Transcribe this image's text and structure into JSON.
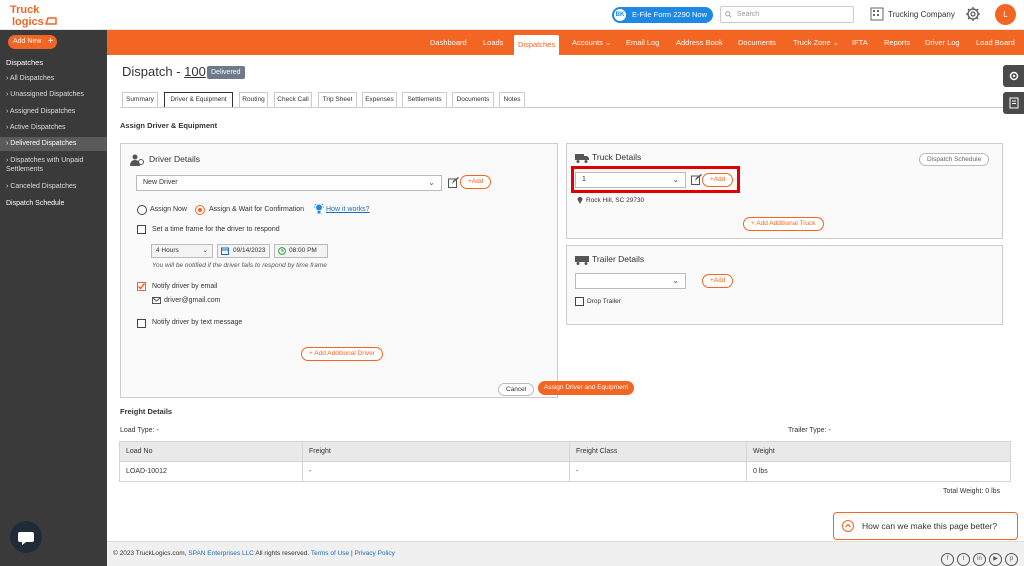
{
  "app": {
    "logo_line1": "Truck",
    "logo_line2": "logics"
  },
  "topbar": {
    "efile_badge": "BK",
    "efile_label": "E-File Form 2290 Now",
    "search_placeholder": "Search",
    "company": "Trucking Company",
    "avatar": "L"
  },
  "sidebar": {
    "add_new": "Add New",
    "section": "Dispatches",
    "items": [
      {
        "label": "All Dispatches"
      },
      {
        "label": "Unassigned Dispatches"
      },
      {
        "label": "Assigned Dispatches"
      },
      {
        "label": "Active Dispatches"
      },
      {
        "label": "Delivered Dispatches"
      },
      {
        "label": "Dispatches with Unpaid Settlements"
      },
      {
        "label": "Canceled Dispatches"
      }
    ],
    "schedule": "Dispatch Schedule"
  },
  "nav": {
    "items": [
      "Dashboard",
      "Loads",
      "Dispatches",
      "Accounts ⌄",
      "Email Log",
      "Address Book",
      "Documents",
      "Truck Zone ⌄",
      "IFTA",
      "Reports",
      "Driver Log",
      "Load Board"
    ]
  },
  "page": {
    "title_prefix": "Dispatch - ",
    "dispatch_no": "100",
    "status": "Delivered"
  },
  "tabs": [
    "Summary",
    "Driver & Equipment",
    "Routing",
    "Check Call",
    "Trip Sheet",
    "Expenses",
    "Settlements",
    "Documents",
    "Notes"
  ],
  "assign": {
    "heading": "Assign Driver & Equipment",
    "driver": {
      "title": "Driver Details",
      "select_value": "New Driver",
      "add": "+Add",
      "assign_now": "Assign Now",
      "assign_wait": "Assign & Wait for Confirmation",
      "how": "How it works?",
      "timeframe": "Set a time frame for the driver to respond",
      "hours": "4 Hours",
      "date": "09/14/2023",
      "time": "08:00 PM",
      "note": "You will be notified if the driver fails to respond by time frame",
      "notify_email": "Notify driver by email",
      "email": "driver@gmail.com",
      "notify_text": "Notify driver by text message",
      "add_additional": "+ Add Additional Driver"
    },
    "truck": {
      "title": "Truck Details",
      "schedule": "Dispatch Schedule",
      "select_value": "1",
      "add": "+Add",
      "location": "Rock Hill, SC 29730",
      "add_additional": "+ Add Additional Truck"
    },
    "trailer": {
      "title": "Trailer Details",
      "select_value": "",
      "add": "+Add",
      "drop": "Drop Trailer"
    },
    "cancel": "Cancel",
    "submit": "Assign Driver and Equipment"
  },
  "freight": {
    "heading": "Freight Details",
    "load_type": "Load Type: -",
    "trailer_type": "Trailer Type: -",
    "columns": [
      "Load No",
      "Freight",
      "Freight Class",
      "Weight"
    ],
    "rows": [
      [
        "LOAD-10012",
        "-",
        "-",
        "0 lbs"
      ]
    ],
    "total": "Total Weight:   0 lbs"
  },
  "feedback": "How can we make this page better?",
  "footer": {
    "copy": "© 2023 TruckLogics.com, ",
    "span": "SPAN Enterprises LLC",
    "rights": " All rights reserved. ",
    "terms": "Terms of Use",
    "sep": " | ",
    "privacy": "Privacy Policy"
  },
  "colors": {
    "brand": "#f26522",
    "sidebar": "#3a3a3a",
    "highlight": "#e00000"
  }
}
